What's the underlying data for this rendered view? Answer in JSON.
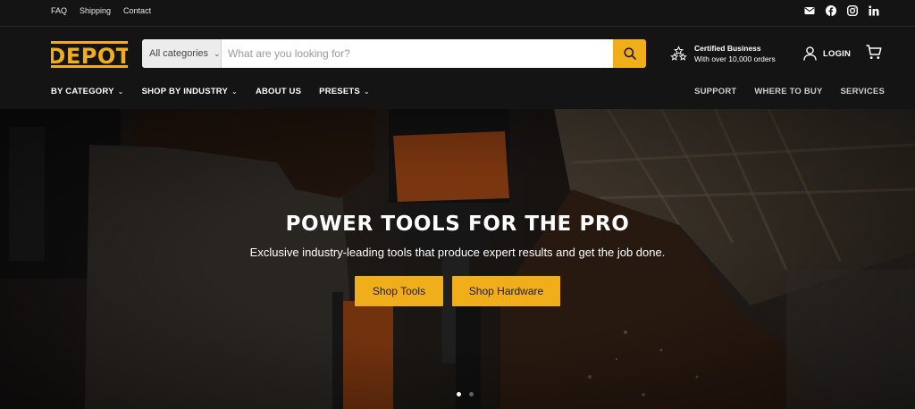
{
  "topbar": {
    "links": [
      "FAQ",
      "Shipping",
      "Contact"
    ],
    "social_icons": [
      "mail-icon",
      "facebook-icon",
      "instagram-icon",
      "linkedin-icon"
    ]
  },
  "header": {
    "logo_text": "DEPOT",
    "search": {
      "category_label": "All categories",
      "placeholder": "What are you looking for?"
    },
    "certified": {
      "title": "Certified Business",
      "subtitle": "With over 10,000 orders"
    },
    "login_label": "LOGIN"
  },
  "nav": {
    "left": [
      "BY CATEGORY",
      "SHOP BY INDUSTRY",
      "ABOUT US",
      "PRESETS"
    ],
    "right": [
      "SUPPORT",
      "WHERE TO BUY",
      "SERVICES"
    ]
  },
  "hero": {
    "title": "POWER TOOLS FOR THE PRO",
    "subtitle": "Exclusive industry-leading tools that produce expert results and get the job done.",
    "buttons": [
      "Shop Tools",
      "Shop Hardware"
    ],
    "slide_count": 2,
    "active_slide": 1
  },
  "colors": {
    "accent": "#f0ae1a",
    "background": "#141414",
    "tool_orange": "#e8661e"
  }
}
